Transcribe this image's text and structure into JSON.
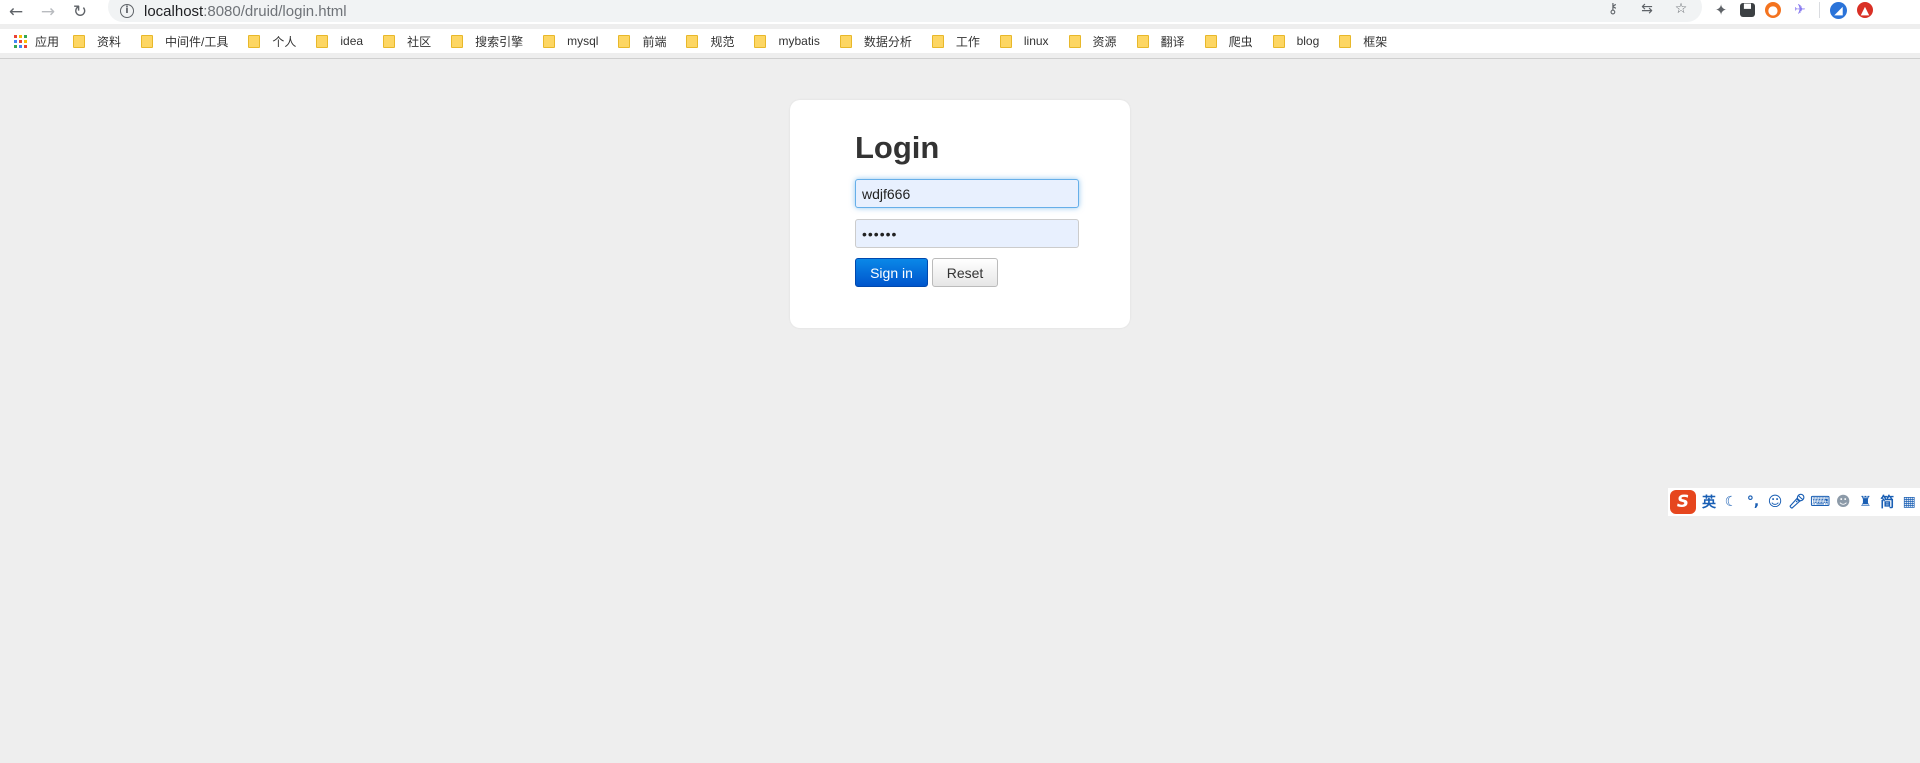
{
  "browser": {
    "url_host": "localhost",
    "url_rest": ":8080/druid/login.html",
    "back_icon": "arrow-left-icon",
    "forward_icon": "arrow-right-icon",
    "reload_icon": "reload-icon"
  },
  "bookmarks": {
    "apps_label": "应用",
    "items": [
      "资料",
      "中间件/工具",
      "个人",
      "idea",
      "社区",
      "搜索引擎",
      "mysql",
      "前端",
      "规范",
      "mybatis",
      "数据分析",
      "工作",
      "linux",
      "资源",
      "翻译",
      "爬虫",
      "blog",
      "框架"
    ]
  },
  "login": {
    "title": "Login",
    "username_value": "wdjf666",
    "password_mask": "••••••",
    "signin_label": "Sign in",
    "reset_label": "Reset"
  },
  "ime": {
    "logo": "S",
    "mode": "英",
    "simplified": "简"
  },
  "colors": {
    "page_bg": "#eeeeee",
    "primary_button": "#0066dd",
    "input_bg": "#e8f0fe",
    "focus_glow": "#66afe9"
  }
}
